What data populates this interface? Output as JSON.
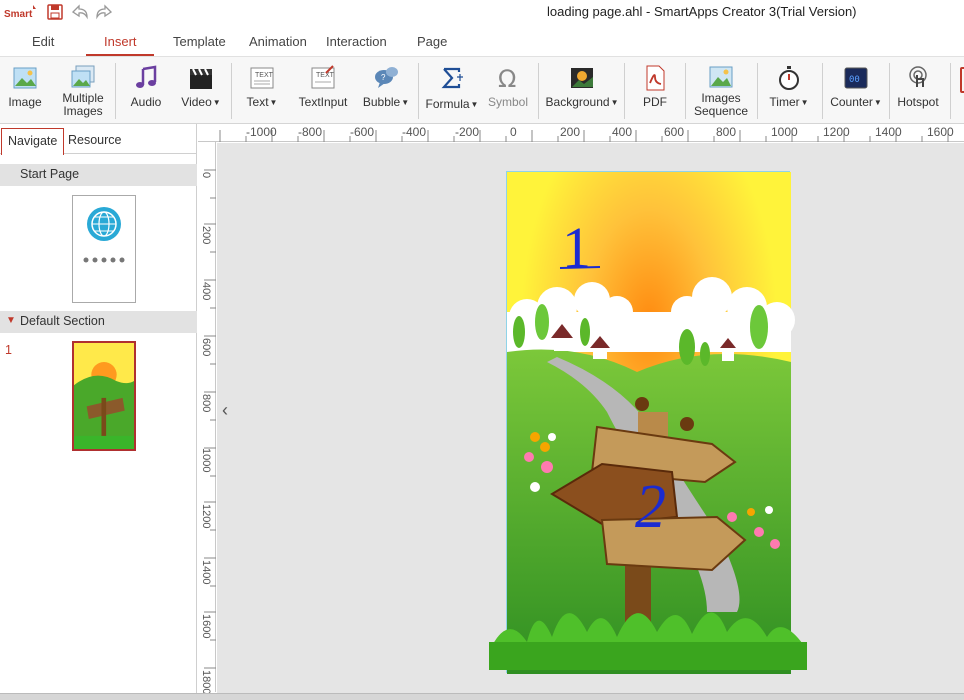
{
  "app": {
    "logo_text": "Smart",
    "window_title": "loading page.ahl - SmartApps Creator 3(Trial Version)"
  },
  "menu": {
    "tabs": [
      "Edit",
      "Insert",
      "Template",
      "Animation",
      "Interaction",
      "Page"
    ],
    "active": "Insert"
  },
  "ribbon": {
    "image": "Image",
    "multiple_images_1": "Multiple",
    "multiple_images_2": "Images",
    "audio": "Audio",
    "video": "Video",
    "text": "Text",
    "textinput": "TextInput",
    "bubble": "Bubble",
    "formula": "Formula",
    "symbol": "Symbol",
    "background": "Background",
    "pdf": "PDF",
    "images_sequence_1": "Images",
    "images_sequence_2": "Sequence",
    "timer": "Timer",
    "counter": "Counter",
    "hotspot": "Hotspot"
  },
  "left_panel": {
    "tabs": [
      "Navigate",
      "Resource"
    ],
    "active_tab": "Navigate",
    "start_page_label": "Start Page",
    "section_label": "Default Section",
    "page_number": "1"
  },
  "ruler": {
    "horizontal": [
      "-1000",
      "-800",
      "-600",
      "-400",
      "-200",
      "0",
      "200",
      "400",
      "600",
      "800",
      "1000",
      "1200",
      "1400",
      "1600"
    ],
    "vertical": [
      "0",
      "200",
      "400",
      "600",
      "800",
      "1000",
      "1200",
      "1400",
      "1600",
      "1800"
    ]
  },
  "canvas": {
    "annotation_1": "1",
    "annotation_2": "2"
  },
  "colors": {
    "accent": "#c0392b",
    "stage_border": "#8fd3e8",
    "sky_top": "#fff23a",
    "sun": "#ff9a1f",
    "grass": "#3fa52a"
  }
}
